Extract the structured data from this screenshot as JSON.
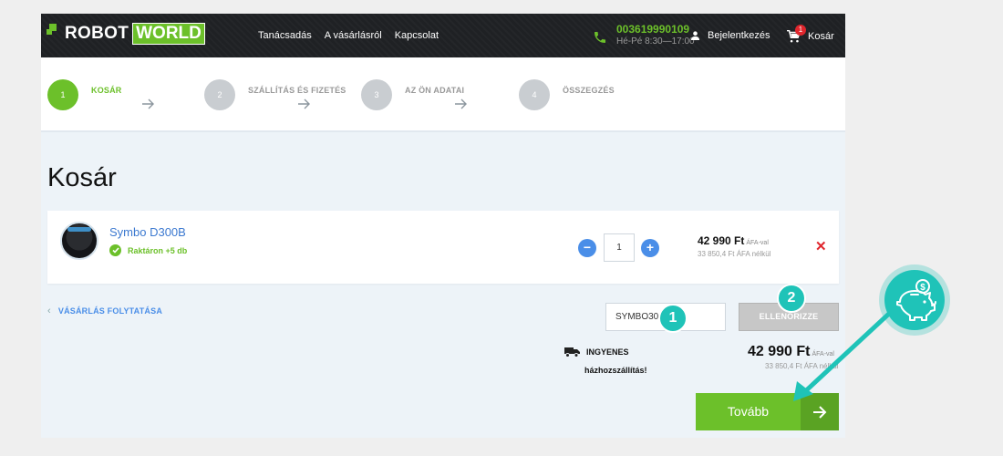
{
  "header": {
    "logo_left": "ROBOT",
    "logo_right": "WORLD",
    "nav": [
      "Tanácsadás",
      "A vásárlásról",
      "Kapcsolat"
    ],
    "phone_number": "003619990109",
    "phone_hours": "Hé-Pé 8:30—17:00",
    "login_label": "Bejelentkezés",
    "cart_label": "Kosár",
    "cart_count": "1"
  },
  "steps": [
    {
      "number": "1",
      "label": "KOSÁR",
      "active": true
    },
    {
      "number": "2",
      "label": "SZÁLLÍTÁS ÉS FIZETÉS",
      "active": false
    },
    {
      "number": "3",
      "label": "AZ ÖN ADATAI",
      "active": false
    },
    {
      "number": "4",
      "label": "ÖSSZEGZÉS",
      "active": false
    }
  ],
  "page_title": "Kosár",
  "item": {
    "name": "Symbo D300B",
    "stock": "Raktáron +5 db",
    "quantity": "1",
    "price": "42 990 Ft",
    "price_vat_note": "ÁFA-val",
    "price_net": "33 850,4 Ft ÁFA nélkül"
  },
  "continue_label": "VÁSÁRLÁS FOLYTATÁSA",
  "coupon": {
    "value": "SYMBO30",
    "button": "ELLENŐRIZZE"
  },
  "shipping": {
    "line1": "INGYENES",
    "line2": "házhozszállítás!"
  },
  "total": {
    "amount": "42 990 Ft",
    "vat_note": "ÁFA-val",
    "net": "33 850,4 Ft ÁFA nélkül"
  },
  "next_button": "Tovább",
  "annotations": {
    "badge1": "1",
    "badge2": "2",
    "icon": "piggy-bank-dollar-icon"
  },
  "colors": {
    "brand_green": "#6cc02a",
    "link_blue": "#4a8ee8",
    "accent_teal": "#1fc3b8",
    "remove_red": "#e0262d"
  }
}
